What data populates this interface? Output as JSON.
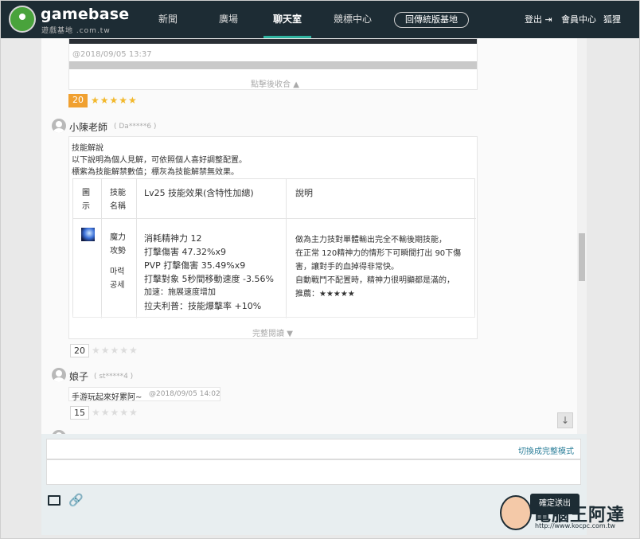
{
  "header": {
    "logo_word": "gamebase",
    "logo_sub": "遊戲基地 .com.tw",
    "nav": [
      "新聞",
      "廣場",
      "聊天室",
      "競標中心"
    ],
    "base_button": "回傳統版基地",
    "logout": "登出",
    "member_center": "會員中心",
    "user": "狐狸"
  },
  "colors": {
    "topbar": "#1d2c34",
    "accent": "#2fb3a0",
    "score_bg": "#f0a030",
    "star_on": "#f2b82c",
    "star_off": "#dcdcdc"
  },
  "post1": {
    "timestamp": "@2018/09/05 13:37",
    "collapse_label": "點擊後收合",
    "score": "20",
    "stars": "★★★★★"
  },
  "post2": {
    "name": "小陳老師",
    "id": "( Da*****6 )",
    "heading": "技能解說",
    "line1": "以下說明為個人見解，可依照個人喜好調整配置。",
    "line2": "標紫為技能解禁數值；標灰為技能解禁無效果。",
    "table": {
      "headers": [
        "圖示",
        "技能名稱",
        "Lv25 技能效果(含特性加總)",
        "說明"
      ],
      "header_col0": [
        "圖",
        "示"
      ],
      "header_col1": [
        "技能",
        "名稱"
      ],
      "skill_name": [
        "魔力",
        "攻勢",
        "",
        "마력",
        "공세"
      ],
      "effects": [
        "消耗精神力 12",
        "打擊傷害 47.32%x9",
        "PVP 打擊傷害 35.49%x9",
        "打擊對象 5秒間移動速度 -3.56%",
        "加速：施展速度增加",
        "拉夫利普：技能爆擊率 +10%"
      ],
      "desc": [
        "做為主力技對單體輸出完全不輸後期技能，",
        "在正常 120精神力的情形下可瞬間打出 90下傷",
        "害，讓對手的血掉得非常快。",
        "自動戰鬥不配置時，精神力很明顯都是滿的，",
        "推薦：★★★★★"
      ]
    },
    "expand_label": "完整閱讀",
    "score": "20",
    "stars": "★★★★★"
  },
  "post3": {
    "name": "娘子",
    "id": "( st*****4 )",
    "comment": "手游玩起來好累阿~",
    "timestamp": "@2018/09/05 14:02",
    "score": "15",
    "stars": "★★★★★"
  },
  "composer": {
    "switch_label": "切換成完整模式",
    "submit_label": "確定送出",
    "image_icon": "image-icon",
    "link_icon": "link-icon"
  },
  "watermark": {
    "text": "電腦王阿達",
    "url": "http://www.kocpc.com.tw"
  }
}
